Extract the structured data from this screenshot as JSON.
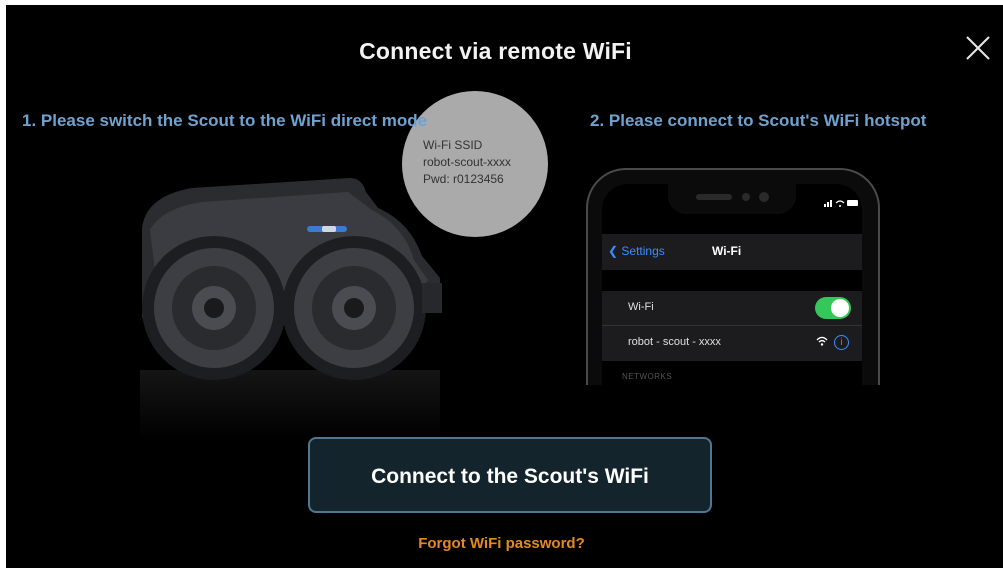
{
  "dialog": {
    "title": "Connect via remote WiFi",
    "close_icon": "close-icon"
  },
  "step1": {
    "text": "1. Please switch the Scout to the WiFi direct mode",
    "ssid_label": "Wi-Fi SSID",
    "ssid_value": "robot-scout-xxxx",
    "password": "Pwd: r0123456"
  },
  "step2": {
    "text": "2. Please connect to Scout's WiFi hotspot",
    "phone": {
      "back_label": "Settings",
      "nav_title": "Wi-Fi",
      "wifi_row_label": "Wi-Fi",
      "wifi_enabled": true,
      "network_name": "robot - scout - xxxx",
      "networks_header": "NETWORKS"
    }
  },
  "actions": {
    "connect_label": "Connect to the Scout's WiFi",
    "forgot_label": "Forgot WiFi password?"
  },
  "colors": {
    "step_text": "#6fa2cf",
    "forgot_text": "#e58a22",
    "button_bg": "#13242d",
    "button_border": "#4f7790",
    "toggle_on": "#34c759",
    "ios_blue": "#3a8dff"
  }
}
